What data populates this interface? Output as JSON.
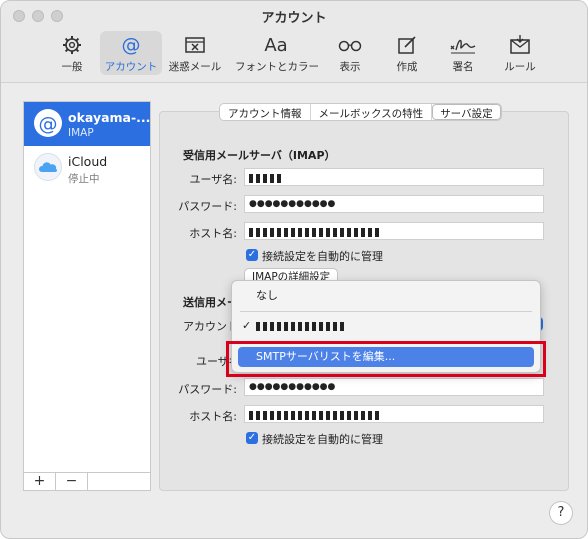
{
  "window": {
    "title": "アカウント"
  },
  "toolbar": {
    "items": [
      {
        "label": "一般",
        "icon": "gear-icon"
      },
      {
        "label": "アカウント",
        "icon": "at-icon",
        "active": true
      },
      {
        "label": "迷惑メール",
        "icon": "junk-icon"
      },
      {
        "label": "フォントとカラー",
        "icon": "font-icon"
      },
      {
        "label": "表示",
        "icon": "glasses-icon"
      },
      {
        "label": "作成",
        "icon": "compose-icon"
      },
      {
        "label": "署名",
        "icon": "signature-icon"
      },
      {
        "label": "ルール",
        "icon": "rules-icon"
      }
    ]
  },
  "sidebar": {
    "accounts": [
      {
        "name": "okayama-...",
        "type": "IMAP",
        "selected": true,
        "icon": "at-icon"
      },
      {
        "name": "iCloud",
        "type": "停止中",
        "selected": false,
        "icon": "cloud-icon"
      }
    ],
    "add_label": "+",
    "remove_label": "−"
  },
  "tabs": {
    "items": [
      "アカウント情報",
      "メールボックスの特性",
      "サーバ設定"
    ],
    "selected": "サーバ設定"
  },
  "incoming": {
    "heading": "受信用メールサーバ（IMAP）",
    "username_label": "ユーザ名:",
    "password_label": "パスワード:",
    "password_value": "●●●●●●●●●●●",
    "host_label": "ホスト名:",
    "auto_manage_label": "接続設定を自動的に管理",
    "advanced_button": "IMAPの詳細設定"
  },
  "outgoing": {
    "heading": "送信用メー",
    "account_label": "アカウント",
    "username_label": "ユーザ名",
    "password_label": "パスワード:",
    "password_value": "●●●●●●●●●●●",
    "host_label": "ホスト名:",
    "auto_manage_label": "接続設定を自動的に管理"
  },
  "menu": {
    "items": [
      {
        "label": "なし"
      },
      {
        "label": "",
        "checked": true,
        "check_mark": "✓"
      },
      {
        "label": "SMTPサーバリストを編集...",
        "highlighted": true
      }
    ]
  },
  "help": {
    "label": "?"
  },
  "colors": {
    "accent": "#2b6fe0",
    "highlight": "#4c82e8",
    "annotation": "#d9001b"
  }
}
